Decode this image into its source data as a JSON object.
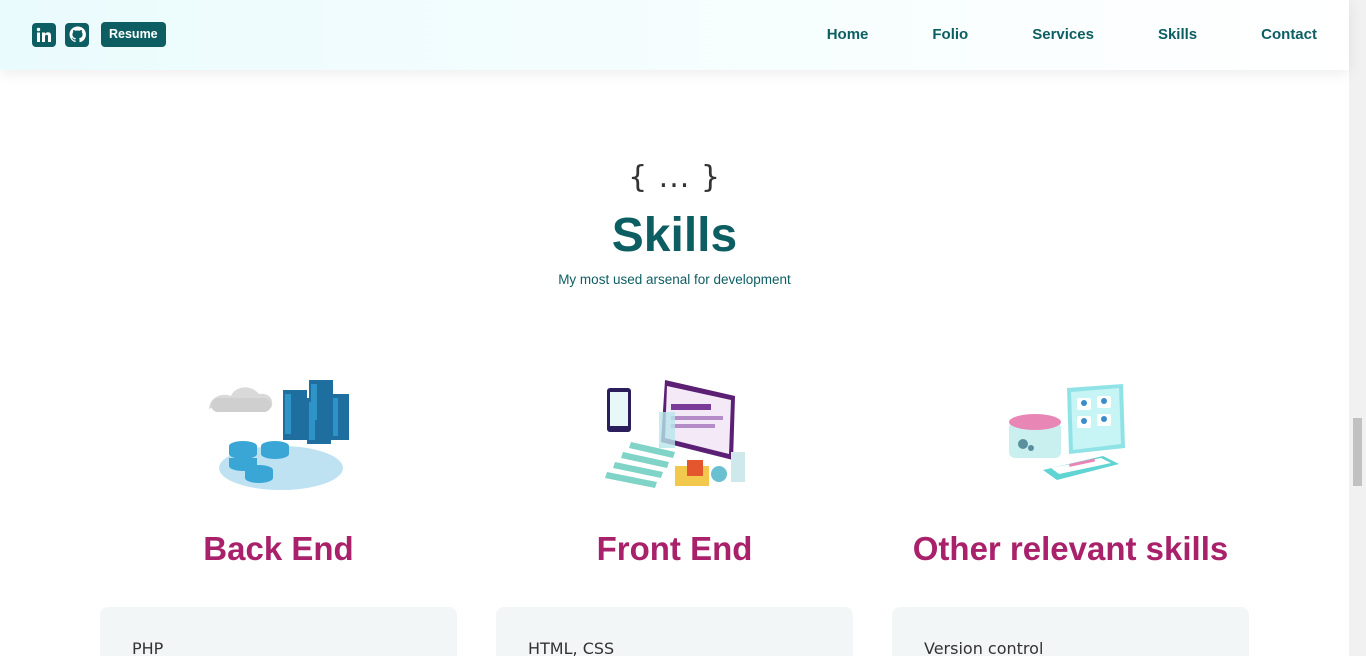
{
  "header": {
    "social": [
      {
        "icon": "linkedin-icon"
      },
      {
        "icon": "github-icon"
      }
    ],
    "resume_label": "Resume",
    "nav": [
      "Home",
      "Folio",
      "Services",
      "Skills",
      "Contact"
    ]
  },
  "section": {
    "braces": "{ ... }",
    "title": "Skills",
    "subtitle": "My most used arsenal for development"
  },
  "columns": [
    {
      "title": "Back End",
      "illustration": "server-cloud-illustration",
      "first_item": "PHP"
    },
    {
      "title": "Front End",
      "illustration": "web-design-illustration",
      "first_item": "HTML, CSS"
    },
    {
      "title": "Other relevant skills",
      "illustration": "devices-illustration",
      "first_item": "Version control"
    }
  ],
  "colors": {
    "primary": "#0d5e63",
    "accent": "#a8216a",
    "card": "#f3f6f6"
  }
}
